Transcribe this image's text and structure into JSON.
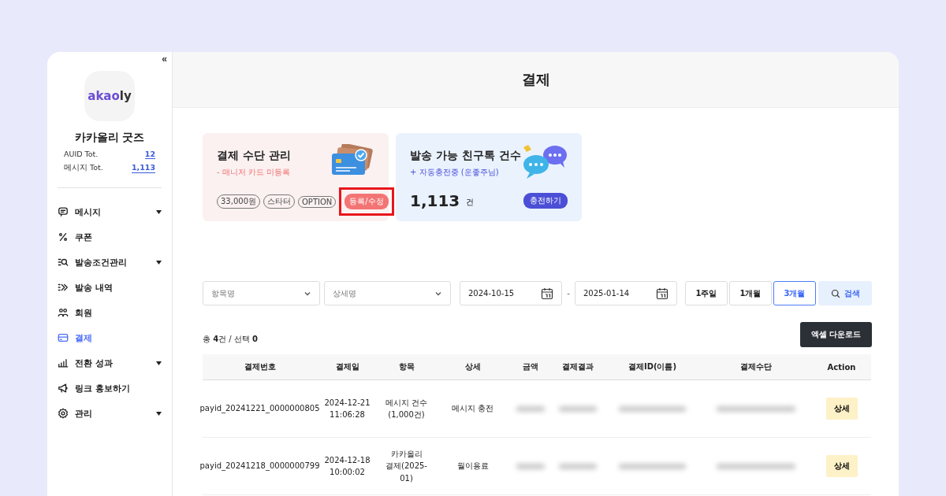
{
  "sidebar": {
    "collapse": "«",
    "logo": {
      "accent": "akao",
      "rest": "ly"
    },
    "shop_name": "카카올리 굿즈",
    "stats": [
      {
        "label": "AUID Tot.",
        "value": "12"
      },
      {
        "label": "메시지 Tot.",
        "value": "1,113"
      }
    ],
    "items": [
      {
        "label": "메시지",
        "selected": false,
        "expandable": true
      },
      {
        "label": "쿠폰",
        "selected": false,
        "expandable": false
      },
      {
        "label": "발송조건관리",
        "selected": false,
        "expandable": true
      },
      {
        "label": "발송 내역",
        "selected": false,
        "expandable": false
      },
      {
        "label": "회원",
        "selected": false,
        "expandable": false
      },
      {
        "label": "결제",
        "selected": true,
        "expandable": false
      },
      {
        "label": "전환 성과",
        "selected": false,
        "expandable": true
      },
      {
        "label": "링크 홍보하기",
        "selected": false,
        "expandable": false
      },
      {
        "label": "관리",
        "selected": false,
        "expandable": true
      }
    ]
  },
  "page_title": "결제",
  "payment_card": {
    "title": "결제 수단 관리",
    "notice": "- 매니저 카드 미등록",
    "tags": [
      "33,000원",
      "스타터",
      "OPTION"
    ],
    "button": "등록/수정",
    "highlighted": true
  },
  "message_card": {
    "title": "발송 가능 친구톡 건수",
    "notice": "+ 자동충전중 (운좋주님)",
    "count": "1,113",
    "unit": "건",
    "button": "충전하기"
  },
  "filters": {
    "item_select": {
      "placeholder": "항목명"
    },
    "detail_select": {
      "placeholder": "상세명"
    },
    "start_date": "2024-10-15",
    "separator": "-",
    "end_date": "2025-01-14",
    "periods": [
      {
        "label": "1주일",
        "selected": false
      },
      {
        "label": "1개월",
        "selected": false
      },
      {
        "label": "3개월",
        "selected": true
      }
    ],
    "search": "검색"
  },
  "summary": "총 **4**건 / 선택 **0**",
  "excel_button": "엑셀 다운로드",
  "table": {
    "columns": [
      "결제번호",
      "결제일",
      "항목",
      "상세",
      "금액",
      "결제결과",
      "결제ID(이름)",
      "결제수단",
      "Action"
    ],
    "rows": [
      {
        "cells": [
          "payid_20241221_0000000805",
          "2024-12-21\n11:06:28",
          "메시지 건수\n(1,000건)",
          "메시지 충전",
          {
            "kind": "blurred"
          },
          {
            "kind": "blurred"
          },
          {
            "kind": "blurred"
          },
          {
            "kind": "blurred"
          }
        ],
        "action": "상세"
      },
      {
        "cells": [
          "payid_20241218_0000000799",
          "2024-12-18\n10:00:02",
          "카카올리\n결제(2025-\n01)",
          "월이용료",
          {
            "kind": "blurred"
          },
          {
            "kind": "blurred"
          },
          {
            "kind": "blurred"
          },
          {
            "kind": "blurred"
          }
        ],
        "action": "상세"
      }
    ]
  }
}
